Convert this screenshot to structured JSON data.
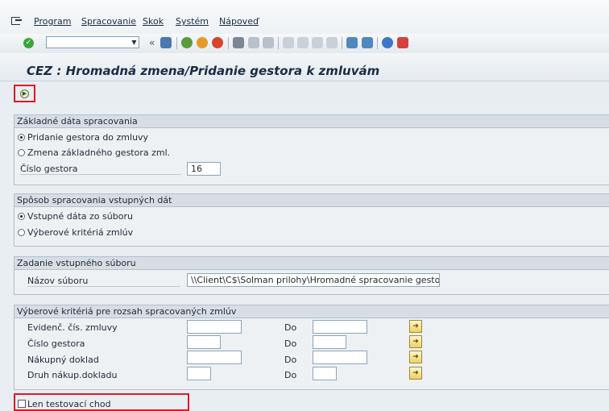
{
  "menu": [
    "Program",
    "Spracovanie",
    "Skok",
    "Systém",
    "Nápoveď"
  ],
  "toolbar": {
    "command_value": ""
  },
  "title": "CEZ : Hromadná zmena/Pridanie gestora k zmluvám",
  "group1": {
    "title": "Základné dáta spracovania",
    "radio1": "Pridanie gestora do zmluvy",
    "radio2": "Zmena základného gestora zml.",
    "gestor_label": "Číslo gestora",
    "gestor_value": "16"
  },
  "group2": {
    "title": "Spôsob spracovania vstupných dát",
    "radio1": "Vstupné dáta zo súboru",
    "radio2": "Výberové kritériá zmlúv"
  },
  "group3": {
    "title": "Zadanie vstupného súboru",
    "file_label": "Názov súboru",
    "file_value": "\\\\Client\\C$\\Solman prilohy\\Hromadné spracovanie gestor..."
  },
  "group4": {
    "title": "Výberové kritériá pre rozsah spracovaných zmlúv",
    "rows": [
      {
        "label": "Evidenč. čís. zmluvy",
        "to": "Do"
      },
      {
        "label": "Číslo gestora",
        "to": "Do"
      },
      {
        "label": "Nákupný doklad",
        "to": "Do"
      },
      {
        "label": "Druh nákup.dokladu",
        "to": "Do"
      }
    ]
  },
  "test_run_label": "Len testovací chod",
  "colors": {
    "highlight": "#e0182b",
    "ok_green": "#3aa63a"
  }
}
